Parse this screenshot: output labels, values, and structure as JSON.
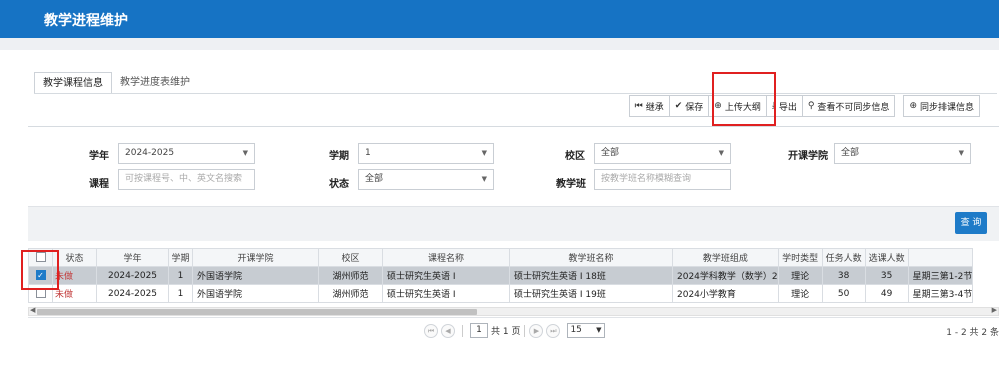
{
  "app": {
    "title": "教学进程维护"
  },
  "tabs": [
    {
      "label": "教学课程信息",
      "active": true
    },
    {
      "label": "教学进度表维护",
      "active": false
    }
  ],
  "toolbar": {
    "inherit": {
      "label": "继承",
      "icon": "inherit-icon"
    },
    "save": {
      "label": "保存",
      "icon": "save-icon"
    },
    "upload": {
      "label": "上传大纲",
      "icon": "upload-icon"
    },
    "export": {
      "label": "导出",
      "icon": "export-icon"
    },
    "view_unsync": {
      "label": "查看不可同步信息",
      "icon": "search-icon"
    },
    "sync": {
      "label": "同步排课信息",
      "icon": "sync-icon"
    }
  },
  "form": {
    "year": {
      "label": "学年",
      "value": "2024-2025"
    },
    "term": {
      "label": "学期",
      "value": "1"
    },
    "campus": {
      "label": "校区",
      "value": "全部"
    },
    "college": {
      "label": "开课学院",
      "value": "全部"
    },
    "course": {
      "label": "课程",
      "placeholder": "可按课程号、中、英文名搜索"
    },
    "status": {
      "label": "状态",
      "value": "全部"
    },
    "class": {
      "label": "教学班",
      "placeholder": "按教学班名称模糊查询"
    },
    "query_button": "查 询"
  },
  "table": {
    "columns": [
      "状态",
      "学年",
      "学期",
      "开课学院",
      "校区",
      "课程名称",
      "教学班名称",
      "教学班组成",
      "学时类型",
      "任务人数",
      "选课人数",
      ""
    ],
    "rows": [
      {
        "checked": true,
        "cells": [
          "未做",
          "2024-2025",
          "1",
          "外国语学院",
          "湖州师范",
          "硕士研究生英语 I",
          "硕士研究生英语 I 18班",
          "2024学科教学（数学）2",
          "理论",
          "38",
          "35",
          "星期三第1-2节"
        ]
      },
      {
        "checked": false,
        "cells": [
          "未做",
          "2024-2025",
          "1",
          "外国语学院",
          "湖州师范",
          "硕士研究生英语 I",
          "硕士研究生英语 I 19班",
          "2024小学教育",
          "理论",
          "50",
          "49",
          "星期三第3-4节"
        ]
      }
    ]
  },
  "pager": {
    "page": "1",
    "total_pages_text": "共 1 页",
    "page_size": "15",
    "info": "1 - 2   共 2 条"
  },
  "colors": {
    "header_blue": "#1673c4",
    "status_red": "#c23b3b",
    "highlight_red": "#e02020"
  }
}
